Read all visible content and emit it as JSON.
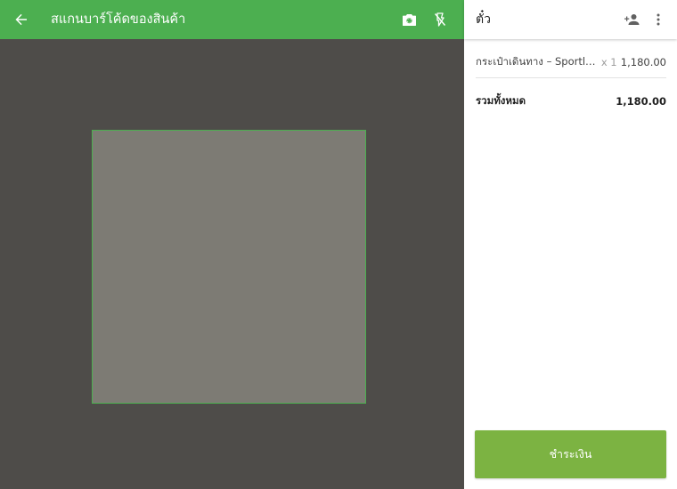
{
  "scanner": {
    "title": "สแกนบาร์โค้ดของสินค้า",
    "icons": {
      "back": "arrow-back-icon",
      "camera": "camera-switch-icon",
      "flash": "flash-off-icon"
    },
    "colors": {
      "bar": "#4caf50",
      "camera_bg": "#4e4c49",
      "frame_fill": "#7d7b74",
      "frame_border": "#4caf50"
    }
  },
  "ticket": {
    "title": "ตั๋ว",
    "icons": {
      "add_customer": "person-add-icon",
      "more": "more-vertical-icon"
    },
    "items": [
      {
        "name": "กระเป๋าเดินทาง – Sportlife...",
        "qty": "x 1",
        "price": "1,180.00"
      }
    ],
    "total_label": "รวมทั้งหมด",
    "total_value": "1,180.00",
    "charge_label": "ชำระเงิน",
    "colors": {
      "charge_button": "#7cb342"
    }
  }
}
